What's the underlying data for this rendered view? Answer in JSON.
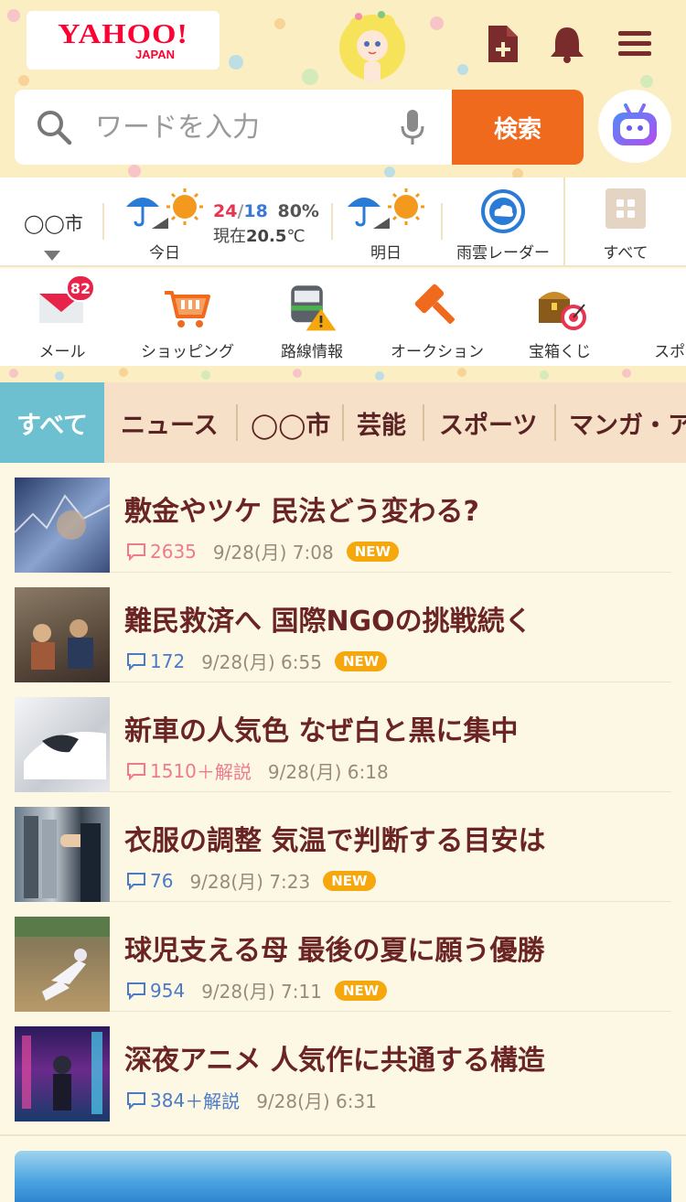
{
  "header": {
    "logo_main": "YAHOO!",
    "logo_sub": "JAPAN",
    "icons": [
      "new-document-icon",
      "bell-icon",
      "menu-icon"
    ]
  },
  "search": {
    "placeholder": "ワードを入力",
    "value": "",
    "button_label": "検索"
  },
  "weather": {
    "city": "◯◯市",
    "today_label": "今日",
    "high": "24",
    "slash": "/",
    "low": "18",
    "precip": "80%",
    "now_prefix": "現在",
    "now_temp": "20.5",
    "now_unit": "℃",
    "tomorrow_label": "明日",
    "radar_label": "雨雲レーダー",
    "all_label": "すべて"
  },
  "services": [
    {
      "label": "メール",
      "badge": "82"
    },
    {
      "label": "ショッピング"
    },
    {
      "label": "路線情報"
    },
    {
      "label": "オークション"
    },
    {
      "label": "宝箱くじ"
    },
    {
      "label": "スポーツ"
    }
  ],
  "tabs": [
    "すべて",
    "ニュース",
    "◯◯市",
    "芸能",
    "スポーツ",
    "マンガ・ア"
  ],
  "news": [
    {
      "title": "敷金やツケ 民法どう変わる?",
      "count": "2635",
      "count_suffix": "",
      "count_color": "#f07a8c",
      "time": "9/28(月) 7:08",
      "new": "NEW"
    },
    {
      "title": "難民救済へ 国際NGOの挑戦続く",
      "count": "172",
      "count_suffix": "",
      "count_color": "#4a7ac8",
      "time": "9/28(月) 6:55",
      "new": "NEW"
    },
    {
      "title": "新車の人気色 なぜ白と黒に集中",
      "count": "1510",
      "count_suffix": "＋解説",
      "count_color": "#f07a8c",
      "time": "9/28(月) 6:18",
      "new": ""
    },
    {
      "title": "衣服の調整 気温で判断する目安は",
      "count": "76",
      "count_suffix": "",
      "count_color": "#4a7ac8",
      "time": "9/28(月) 7:23",
      "new": "NEW"
    },
    {
      "title": "球児支える母 最後の夏に願う優勝",
      "count": "954",
      "count_suffix": "",
      "count_color": "#4a7ac8",
      "time": "9/28(月) 7:11",
      "new": "NEW"
    },
    {
      "title": "深夜アニメ 人気作に共通する構造",
      "count": "384",
      "count_suffix": "＋解説",
      "count_color": "#4a7ac8",
      "time": "9/28(月) 6:31",
      "new": ""
    }
  ],
  "colors": {
    "brand_red": "#ff0033",
    "search_orange": "#f06a1e",
    "tab_active": "#6cc0d0",
    "title_brown": "#6b2424",
    "new_badge": "#f5a70c"
  }
}
